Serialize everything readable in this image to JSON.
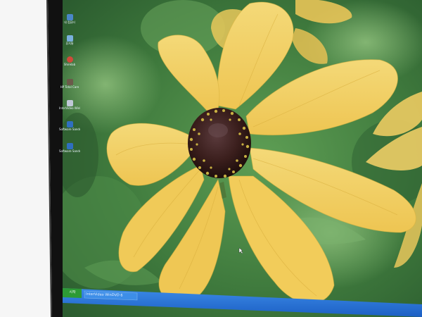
{
  "desktop": {
    "icons": [
      {
        "icon": "folder-icon",
        "label": "내 컴퓨터",
        "color": "#4a86c8"
      },
      {
        "icon": "recycle-bin-icon",
        "label": "휴지통",
        "color": "#7ab0dd"
      },
      {
        "icon": "app-shortcut-icon",
        "label": "Shirelab",
        "color": "#d04a3a"
      },
      {
        "icon": "hp-total-care-icon",
        "label": "HP Total Care",
        "color": "#6b5a4a"
      },
      {
        "icon": "intervideo-icon",
        "label": "InterVideo WinDVD",
        "color": "#c0c8d8"
      },
      {
        "icon": "software-icon",
        "label": "Software Sandra",
        "color": "#2f6fc0"
      },
      {
        "icon": "software-icon",
        "label": "Software Sandra",
        "color": "#2f6fc0"
      }
    ]
  },
  "taskbar": {
    "start_label": "시작",
    "task_label": "InterVideo WinDVD 6"
  },
  "colors": {
    "taskbar": "#1c73d6",
    "start": "#2d9a35",
    "petal": "#f1cd5e",
    "center": "#3a1e1c",
    "leaf": "#3f7a3d"
  }
}
